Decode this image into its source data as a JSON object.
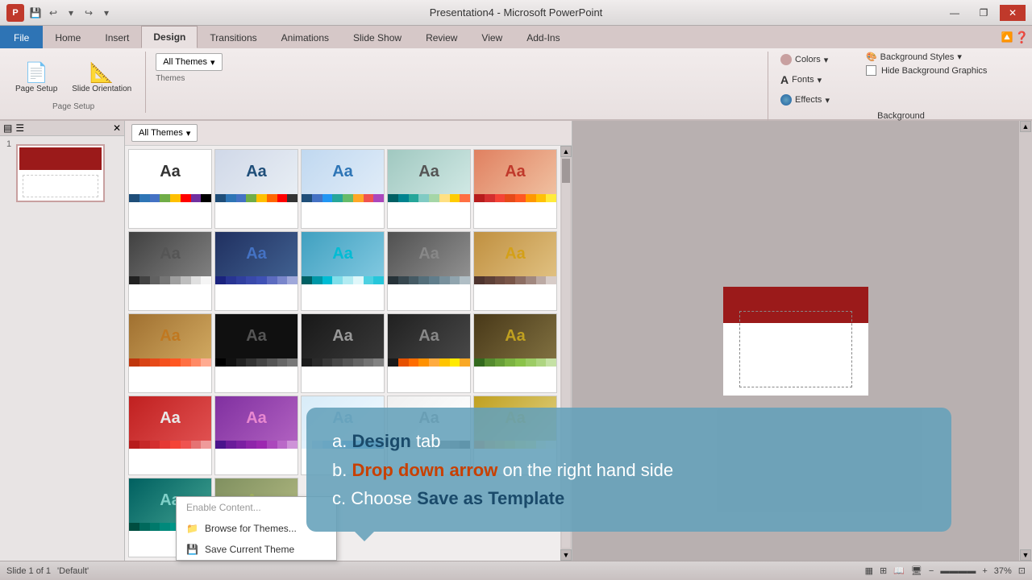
{
  "titlebar": {
    "title": "Presentation4 - Microsoft PowerPoint",
    "ppt_label": "P",
    "min_btn": "—",
    "max_btn": "❐",
    "close_btn": "✕"
  },
  "qat": {
    "save": "💾",
    "undo": "↩",
    "redo": "↪",
    "more": "▾"
  },
  "tabs": [
    "File",
    "Home",
    "Insert",
    "Design",
    "Transitions",
    "Animations",
    "Slide Show",
    "Review",
    "View",
    "Add-Ins"
  ],
  "active_tab": "Design",
  "ribbon": {
    "page_setup_label": "Page Setup",
    "page_setup_btn": "Page Setup",
    "orientation_btn": "Slide Orientation",
    "themes_dropdown": "All Themes",
    "colors_label": "Colors",
    "fonts_label": "Fonts",
    "effects_label": "Effects",
    "bg_styles_label": "Background Styles",
    "hide_bg_label": "Hide Background Graphics",
    "background_label": "Background"
  },
  "themes": [
    {
      "id": 1,
      "aa_color": "#333",
      "bg_class": "tp-white",
      "swatches": [
        "#1f4e79",
        "#2e75b6",
        "#4472c4",
        "#70ad47",
        "#ffc000",
        "#ff0000",
        "#7030a0",
        "#000000"
      ]
    },
    {
      "id": 2,
      "aa_color": "#1f4e79",
      "bg_class": "tp-gray-blue",
      "swatches": [
        "#1f4e79",
        "#2e75b6",
        "#4472c4",
        "#70ad47",
        "#ffc000",
        "#ff6600",
        "#ff0000",
        "#333333"
      ]
    },
    {
      "id": 3,
      "aa_color": "#2e75b6",
      "bg_class": "tp-blue",
      "swatches": [
        "#1f4e79",
        "#4472c4",
        "#2196f3",
        "#26a69a",
        "#66bb6a",
        "#ffa726",
        "#ef5350",
        "#ab47bc"
      ]
    },
    {
      "id": 4,
      "aa_color": "#555",
      "bg_class": "tp-teal",
      "swatches": [
        "#006064",
        "#00838f",
        "#26a69a",
        "#80cbc4",
        "#a5d6a7",
        "#ffe082",
        "#ffcc02",
        "#ff7043"
      ]
    },
    {
      "id": 5,
      "aa_color": "#c0392b",
      "bg_class": "tp-orange-red",
      "swatches": [
        "#b71c1c",
        "#d32f2f",
        "#f44336",
        "#e64a19",
        "#ff5722",
        "#ff9800",
        "#ffc107",
        "#ffeb3b"
      ]
    },
    {
      "id": 6,
      "aa_color": "#555",
      "bg_class": "tp-dark-gray",
      "swatches": [
        "#212121",
        "#424242",
        "#616161",
        "#757575",
        "#9e9e9e",
        "#bdbdbd",
        "#e0e0e0",
        "#f5f5f5"
      ]
    },
    {
      "id": 7,
      "aa_color": "#4472c4",
      "bg_class": "tp-dark-blue",
      "swatches": [
        "#1a237e",
        "#283593",
        "#303f9f",
        "#3949ab",
        "#3f51b5",
        "#5c6bc0",
        "#7986cb",
        "#9fa8da"
      ]
    },
    {
      "id": 8,
      "aa_color": "#00bcd4",
      "bg_class": "tp-cyan-blue",
      "swatches": [
        "#006064",
        "#0097a7",
        "#00bcd4",
        "#80deea",
        "#b2ebf2",
        "#e0f7fa",
        "#4dd0e1",
        "#26c6da"
      ]
    },
    {
      "id": 9,
      "aa_color": "#888",
      "bg_class": "tp-dark-gray2",
      "swatches": [
        "#263238",
        "#37474f",
        "#455a64",
        "#546e7a",
        "#607d8b",
        "#78909c",
        "#90a4ae",
        "#b0bec5"
      ]
    },
    {
      "id": 10,
      "aa_color": "#d4a017",
      "bg_class": "tp-brown-gold",
      "swatches": [
        "#4e342e",
        "#5d4037",
        "#6d4c41",
        "#795548",
        "#8d6e63",
        "#a1887f",
        "#bcaaa4",
        "#d7ccc8"
      ]
    },
    {
      "id": 11,
      "aa_color": "#c07820",
      "bg_class": "tp-brown",
      "swatches": [
        "#bf360c",
        "#d84315",
        "#e64a19",
        "#f4511e",
        "#ff5722",
        "#ff7043",
        "#ff8a65",
        "#ffab91"
      ]
    },
    {
      "id": 12,
      "aa_color": "#555",
      "bg_class": "tp-black",
      "swatches": [
        "#000000",
        "#111111",
        "#222222",
        "#333333",
        "#444444",
        "#555555",
        "#666666",
        "#777777"
      ]
    },
    {
      "id": 13,
      "aa_color": "#999",
      "bg_class": "tp-black2",
      "swatches": [
        "#1b1b1b",
        "#2a2a2a",
        "#383838",
        "#474747",
        "#555555",
        "#646464",
        "#737373",
        "#828282"
      ]
    },
    {
      "id": 14,
      "aa_color": "#888",
      "bg_class": "tp-black-orange",
      "swatches": [
        "#1a1a1a",
        "#e65100",
        "#ff6d00",
        "#ff9100",
        "#ffab40",
        "#ffc400",
        "#ffea00",
        "#f9a825"
      ]
    },
    {
      "id": 15,
      "aa_color": "#c0a020",
      "bg_class": "tp-dark-gold",
      "swatches": [
        "#33691e",
        "#558b2f",
        "#689f38",
        "#7cb342",
        "#8bc34a",
        "#9ccc65",
        "#aed581",
        "#c5e1a5"
      ]
    },
    {
      "id": 16,
      "aa_color": "#e8e8e8",
      "bg_class": "tp-red",
      "swatches": [
        "#b71c1c",
        "#c62828",
        "#d32f2f",
        "#e53935",
        "#f44336",
        "#ef5350",
        "#e57373",
        "#ef9a9a"
      ]
    },
    {
      "id": 17,
      "aa_color": "#e888d0",
      "bg_class": "tp-purple",
      "swatches": [
        "#4a148c",
        "#6a1b9a",
        "#7b1fa2",
        "#8e24aa",
        "#9c27b0",
        "#ab47bc",
        "#ba68c8",
        "#ce93d8"
      ]
    },
    {
      "id": 18,
      "aa_color": "#80b0d0",
      "bg_class": "tp-light-blue2",
      "swatches": [
        "#e3f2fd",
        "#bbdefb",
        "#90caf9",
        "#64b5f6",
        "#42a5f5",
        "#2196f3",
        "#1e88e5",
        "#1976d2"
      ]
    },
    {
      "id": 19,
      "aa_color": "#888",
      "bg_class": "tp-white2",
      "swatches": [
        "#f5f5f5",
        "#eeeeee",
        "#e0e0e0",
        "#bdbdbd",
        "#9e9e9e",
        "#757575",
        "#616161",
        "#424242"
      ]
    },
    {
      "id": 20,
      "aa_color": "#c8a000",
      "bg_class": "tp-gold-white",
      "swatches": [
        "#f57f17",
        "#f9a825",
        "#fbc02d",
        "#fdd835",
        "#ffee58",
        "#fff176",
        "#fff9c4",
        "#fffde7"
      ]
    },
    {
      "id": 21,
      "aa_color": "#80d0c8",
      "bg_class": "tp-teal2",
      "swatches": [
        "#004d40",
        "#00695c",
        "#00796b",
        "#00897b",
        "#009688",
        "#26a69a",
        "#4db6ac",
        "#80cbc4"
      ]
    },
    {
      "id": 22,
      "aa_color": "#a0b060",
      "bg_class": "tp-gray-green",
      "swatches": [
        "#33691e",
        "#558b2f",
        "#689f38",
        "#7cb342",
        "#8bc34a",
        "#9ccc65",
        "#aed581",
        "#c5e1a5"
      ]
    }
  ],
  "tooltip": {
    "line_a_prefix": "a. ",
    "line_a_bold": "Design",
    "line_a_suffix": " tab",
    "line_b_prefix": "b. ",
    "line_b_bold": "Drop down arrow",
    "line_b_suffix": " on the right hand side",
    "line_c_prefix": "c. Choose ",
    "line_c_bold": "Save as Template"
  },
  "dropdown_items": [
    {
      "label": "Enable Content...",
      "dimmed": true
    },
    {
      "label": "Browse for Themes...",
      "dimmed": false
    },
    {
      "label": "Save Current Theme",
      "dimmed": false
    }
  ],
  "status": {
    "slide_info": "Slide 1 of 1",
    "default_label": "'Default'",
    "zoom": "37%"
  }
}
